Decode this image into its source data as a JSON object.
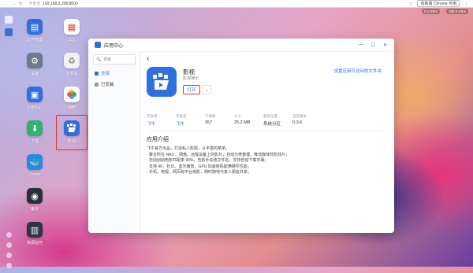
{
  "browser": {
    "security": "不安全",
    "url": "192.168.9.208:8000",
    "chrome_notice": "有新版 Chrome 可用"
  },
  "status": {
    "items": [
      "",
      "",
      "0.1 KB/s",
      "",
      "298.5 KB/s"
    ]
  },
  "desktop": {
    "icons": [
      {
        "label": "文件管理",
        "icon": "folder-icon"
      },
      {
        "label": "日志",
        "icon": "log-icon"
      },
      {
        "label": "设置",
        "icon": "settings-icon"
      },
      {
        "label": "回收站",
        "icon": "recycle-icon"
      },
      {
        "label": "应用中心",
        "icon": "app-center-icon"
      },
      {
        "label": "相册",
        "icon": "photos-icon"
      },
      {
        "label": "下载",
        "icon": "download-icon"
      },
      {
        "label": "影视",
        "icon": "video-icon"
      },
      {
        "label": "Docker",
        "icon": "docker-icon"
      },
      {
        "label": "备份",
        "icon": "backup-icon"
      },
      {
        "label": "资源监控",
        "icon": "monitor-icon"
      }
    ]
  },
  "window": {
    "title": "应用中心",
    "search_placeholder": "搜索",
    "sidebar": [
      {
        "label": "全部",
        "active": true
      },
      {
        "label": "已安装",
        "active": false
      }
    ],
    "app": {
      "name": "影视",
      "subtitle": "影视娱乐",
      "open_label": "打开",
      "more_label": "⌄",
      "settings_link": "设置应用可访问的文件夹"
    },
    "stats": [
      {
        "key": "开发者",
        "value": "飞牛",
        "accent": true
      },
      {
        "key": "开发者",
        "value": "飞牛",
        "accent": true
      },
      {
        "key": "下载数",
        "value": "357",
        "accent": false
      },
      {
        "key": "大小",
        "value": "25.2 MB",
        "accent": false
      },
      {
        "key": "安装位置",
        "value": "系统分区",
        "accent": false
      },
      {
        "key": "当前版本",
        "value": "0.3.6",
        "accent": false
      }
    ],
    "intro_title": "应用介绍",
    "intro_lines": [
      "飞牛官方出品，打造私人影院，从丰富的菜单。",
      "· 聚合所在 NAS 、网盘、远程设备上的影片，自动分类整理，降流媒体轻松找片；",
      "· 自动刮削电影匹配率 99%，告别手动改文件名，支持自动下载字幕；",
      "· 支持 4K、杜比、蓝光播放，GPU 加速转码能满硬件性能；",
      "· 手机、电视、网页跨平台观影，随时随地与家人朋友共享。"
    ]
  },
  "colors": {
    "accent": "#2f6fe0",
    "highlight": "#e03030"
  }
}
